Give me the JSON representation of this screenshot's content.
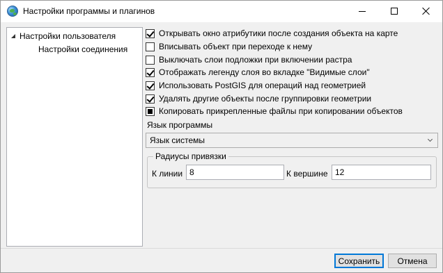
{
  "window": {
    "title": "Настройки программы и плагинов",
    "app_icon": "globe-icon"
  },
  "tree": {
    "items": [
      {
        "label": "Настройки пользователя",
        "expanded": true,
        "selected": true
      },
      {
        "label": "Настройки соединения",
        "expanded": false,
        "selected": false
      }
    ]
  },
  "settings": {
    "checkboxes": [
      {
        "label": "Открывать окно атрибутики после создания объекта на карте",
        "state": "checked"
      },
      {
        "label": "Вписывать объект при переходе к нему",
        "state": "unchecked"
      },
      {
        "label": "Выключать слои подложки при включении растра",
        "state": "unchecked"
      },
      {
        "label": "Отображать легенду слоя во вкладке \"Видимые слои\"",
        "state": "checked"
      },
      {
        "label": "Использовать PostGIS для операций над геометрией",
        "state": "checked"
      },
      {
        "label": "Удалять другие объекты после группировки геометрии",
        "state": "checked"
      },
      {
        "label": "Копировать прикрепленные файлы при копировании объектов",
        "state": "indeterminate"
      }
    ],
    "language": {
      "label": "Язык программы",
      "selected": "Язык системы"
    },
    "snap": {
      "title": "Радиусы привязки",
      "line_label": "К линии",
      "line_value": "8",
      "vertex_label": "К вершине",
      "vertex_value": "12"
    }
  },
  "footer": {
    "save_label": "Сохранить",
    "cancel_label": "Отмена"
  },
  "colors": {
    "accent": "#0078d7",
    "window_bg": "#f0f0f0"
  }
}
